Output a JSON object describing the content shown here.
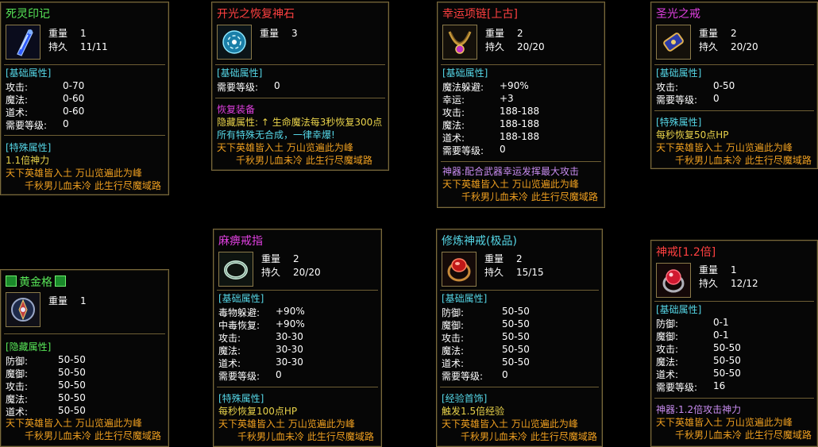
{
  "cards": [
    {
      "id": "siling",
      "title": "死灵印记",
      "weight_label": "重量",
      "weight": "1",
      "dur_label": "持久",
      "dur": "11/11",
      "section1": "[基础属性]",
      "stats": [
        [
          "攻击:",
          "0-70"
        ],
        [
          "魔法:",
          "0-60"
        ],
        [
          "道术:",
          "0-60"
        ],
        [
          "需要等级:",
          "0"
        ]
      ],
      "section2": "[特殊属性]",
      "special": "1.1倍神力",
      "verse1": "天下英雄皆入土 万山览遍此为峰",
      "verse2": "千秋男儿血未冷 此生行尽魔域路"
    },
    {
      "id": "kaiguang",
      "title": "开光之恢复神石",
      "weight_label": "重量",
      "weight": "3",
      "section1": "[基础属性]",
      "stats": [
        [
          "需要等级:",
          "0"
        ]
      ],
      "section2": "恢复装备",
      "hidden": "隐藏属性: ↑ 生命魔法每3秒恢复300点",
      "note": "所有特殊无合成，一律幸爆!",
      "verse1": "天下英雄皆入土 万山览遍此为峰",
      "verse2": "千秋男儿血未冷 此生行尽魔域路"
    },
    {
      "id": "xingyun",
      "title": "幸运项链[上古]",
      "weight_label": "重量",
      "weight": "2",
      "dur_label": "持久",
      "dur": "20/20",
      "section1": "[基础属性]",
      "stats": [
        [
          "魔法躲避:",
          "+90%"
        ],
        [
          "幸运:",
          "+3"
        ],
        [
          "攻击:",
          "188-188"
        ],
        [
          "魔法:",
          "188-188"
        ],
        [
          "道术:",
          "188-188"
        ],
        [
          "需要等级:",
          "0"
        ]
      ],
      "shenqi": "神器:配合武器幸运发挥最大攻击",
      "verse1": "天下英雄皆入土 万山览遍此为峰",
      "verse2": "千秋男儿血未冷 此生行尽魔域路"
    },
    {
      "id": "shengguang",
      "title": "圣光之戒",
      "weight_label": "重量",
      "weight": "2",
      "dur_label": "持久",
      "dur": "20/20",
      "section1": "[基础属性]",
      "stats": [
        [
          "攻击:",
          "0-50"
        ],
        [
          "需要等级:",
          "0"
        ]
      ],
      "section2": "[特殊属性]",
      "special": "每秒恢复50点HP",
      "verse1": "天下英雄皆入土 万山览遍此为峰",
      "verse2": "千秋男儿血未冷 此生行尽魔域路"
    },
    {
      "id": "huangjin",
      "title": "黄金格",
      "weight_label": "重量",
      "weight": "1",
      "section1": "[隐藏属性]",
      "stats": [
        [
          "防御:",
          "50-50"
        ],
        [
          "魔御:",
          "50-50"
        ],
        [
          "攻击:",
          "50-50"
        ],
        [
          "魔法:",
          "50-50"
        ],
        [
          "道术:",
          "50-50"
        ]
      ],
      "verse1": "天下英雄皆入土 万山览遍此为峰",
      "verse2": "千秋男儿血未冷 此生行尽魔域路"
    },
    {
      "id": "mobi",
      "title": "麻痹戒指",
      "weight_label": "重量",
      "weight": "2",
      "dur_label": "持久",
      "dur": "20/20",
      "section1": "[基础属性]",
      "stats": [
        [
          "毒物躲避:",
          "+90%"
        ],
        [
          "中毒恢复:",
          "+90%"
        ],
        [
          "攻击:",
          "30-30"
        ],
        [
          "魔法:",
          "30-30"
        ],
        [
          "道术:",
          "30-30"
        ],
        [
          "需要等级:",
          "0"
        ]
      ],
      "section2": "[特殊属性]",
      "special": "每秒恢复100点HP",
      "verse1": "天下英雄皆入土 万山览遍此为峰",
      "verse2": "千秋男儿血未冷 此生行尽魔域路"
    },
    {
      "id": "xiulian",
      "title": "修炼神戒(极品)",
      "weight_label": "重量",
      "weight": "2",
      "dur_label": "持久",
      "dur": "15/15",
      "section1": "[基础属性]",
      "stats": [
        [
          "防御:",
          "50-50"
        ],
        [
          "魔御:",
          "50-50"
        ],
        [
          "攻击:",
          "50-50"
        ],
        [
          "魔法:",
          "50-50"
        ],
        [
          "道术:",
          "50-50"
        ],
        [
          "需要等级:",
          "0"
        ]
      ],
      "section2": "[经验首饰]",
      "special": "触发1.5倍经验",
      "verse1": "天下英雄皆入土 万山览遍此为峰",
      "verse2": "千秋男儿血未冷 此生行尽魔域路"
    },
    {
      "id": "shenjie",
      "title": "神戒[1.2倍]",
      "weight_label": "重量",
      "weight": "1",
      "dur_label": "持久",
      "dur": "12/12",
      "section1": "[基础属性]",
      "stats": [
        [
          "防御:",
          "0-1"
        ],
        [
          "魔御:",
          "0-1"
        ],
        [
          "攻击:",
          "50-50"
        ],
        [
          "魔法:",
          "50-50"
        ],
        [
          "道术:",
          "50-50"
        ],
        [
          "需要等级:",
          "16"
        ]
      ],
      "shenqi": "神器:1.2倍攻击神力",
      "verse1": "天下英雄皆入土 万山览遍此为峰",
      "verse2": "千秋男儿血未冷 此生行尽魔域路"
    }
  ]
}
